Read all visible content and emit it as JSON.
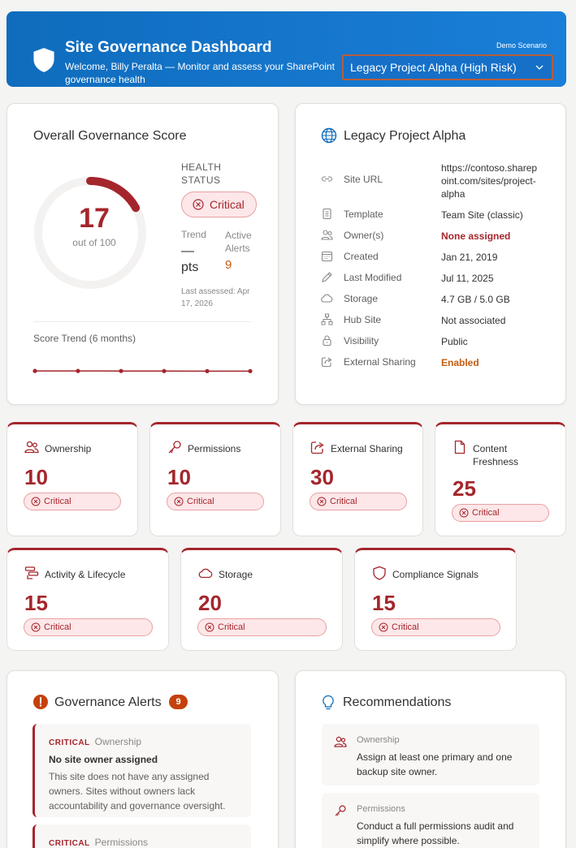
{
  "header": {
    "title": "Site Governance Dashboard",
    "subtitle": "Welcome, Billy Peralta — Monitor and assess your SharePoint governance health",
    "demo_label": "Demo Scenario",
    "scenario_selected": "Legacy Project Alpha (High Risk)"
  },
  "score": {
    "title": "Overall Governance Score",
    "value": "17",
    "value_fraction": 0.17,
    "out_of": "out of 100",
    "health_label": "HEALTH STATUS",
    "health_status": "Critical",
    "trend_label": "Trend",
    "trend_value": "— pts",
    "alerts_label": "Active Alerts",
    "alerts_value": "9",
    "last_assessed": "Last assessed: Apr 17, 2026",
    "trend_title": "Score Trend (6 months)",
    "trend_data": [
      22,
      21,
      20,
      18,
      17,
      17
    ]
  },
  "site": {
    "name": "Legacy Project Alpha",
    "rows": [
      {
        "label": "Site URL",
        "value": "https://contoso.sharepoint.com/sites/project-alpha",
        "icon": "link-icon"
      },
      {
        "label": "Template",
        "value": "Team Site (classic)",
        "icon": "template-icon"
      },
      {
        "label": "Owner(s)",
        "value": "None assigned",
        "icon": "people-icon"
      },
      {
        "label": "Created",
        "value": "Jan 21, 2019",
        "icon": "calendar-icon"
      },
      {
        "label": "Last Modified",
        "value": "Jul 11, 2025",
        "icon": "pencil-icon"
      },
      {
        "label": "Storage",
        "value": "4.7 GB / 5.0 GB",
        "icon": "cloud-icon"
      },
      {
        "label": "Hub Site",
        "value": "Not associated",
        "icon": "hub-icon"
      },
      {
        "label": "Visibility",
        "value": "Public",
        "icon": "lock-icon"
      },
      {
        "label": "External Sharing",
        "value": "Enabled",
        "icon": "share-icon"
      }
    ]
  },
  "categories": [
    {
      "name": "Ownership",
      "score": "10",
      "status": "Critical",
      "icon": "people-icon"
    },
    {
      "name": "Permissions",
      "score": "10",
      "status": "Critical",
      "icon": "key-icon"
    },
    {
      "name": "External Sharing",
      "score": "30",
      "status": "Critical",
      "icon": "share-icon"
    },
    {
      "name": "Content Freshness",
      "score": "25",
      "status": "Critical",
      "icon": "document-icon"
    },
    {
      "name": "Activity & Lifecycle",
      "score": "15",
      "status": "Critical",
      "icon": "activity-icon"
    },
    {
      "name": "Storage",
      "score": "20",
      "status": "Critical",
      "icon": "cloud-icon"
    },
    {
      "name": "Compliance Signals",
      "score": "15",
      "status": "Critical",
      "icon": "shield-icon"
    }
  ],
  "alerts": {
    "title": "Governance Alerts",
    "count": "9",
    "items": [
      {
        "severity": "CRITICAL",
        "category": "Ownership",
        "title": "No site owner assigned",
        "description": "This site does not have any assigned owners. Sites without owners lack accountability and governance oversight."
      },
      {
        "severity": "CRITICAL",
        "category": "Permissions",
        "title": "",
        "description": ""
      }
    ]
  },
  "recommendations": {
    "title": "Recommendations",
    "items": [
      {
        "category": "Ownership",
        "text": "Assign at least one primary and one backup site owner.",
        "icon": "people-icon"
      },
      {
        "category": "Permissions",
        "text": "Conduct a full permissions audit and simplify where possible.",
        "icon": "key-icon"
      }
    ]
  },
  "colors": {
    "header_blue": "#0f6cbd",
    "critical_red": "#a4262c",
    "warning_orange": "#c45c10",
    "gauge_track": "#f3f2f1"
  }
}
